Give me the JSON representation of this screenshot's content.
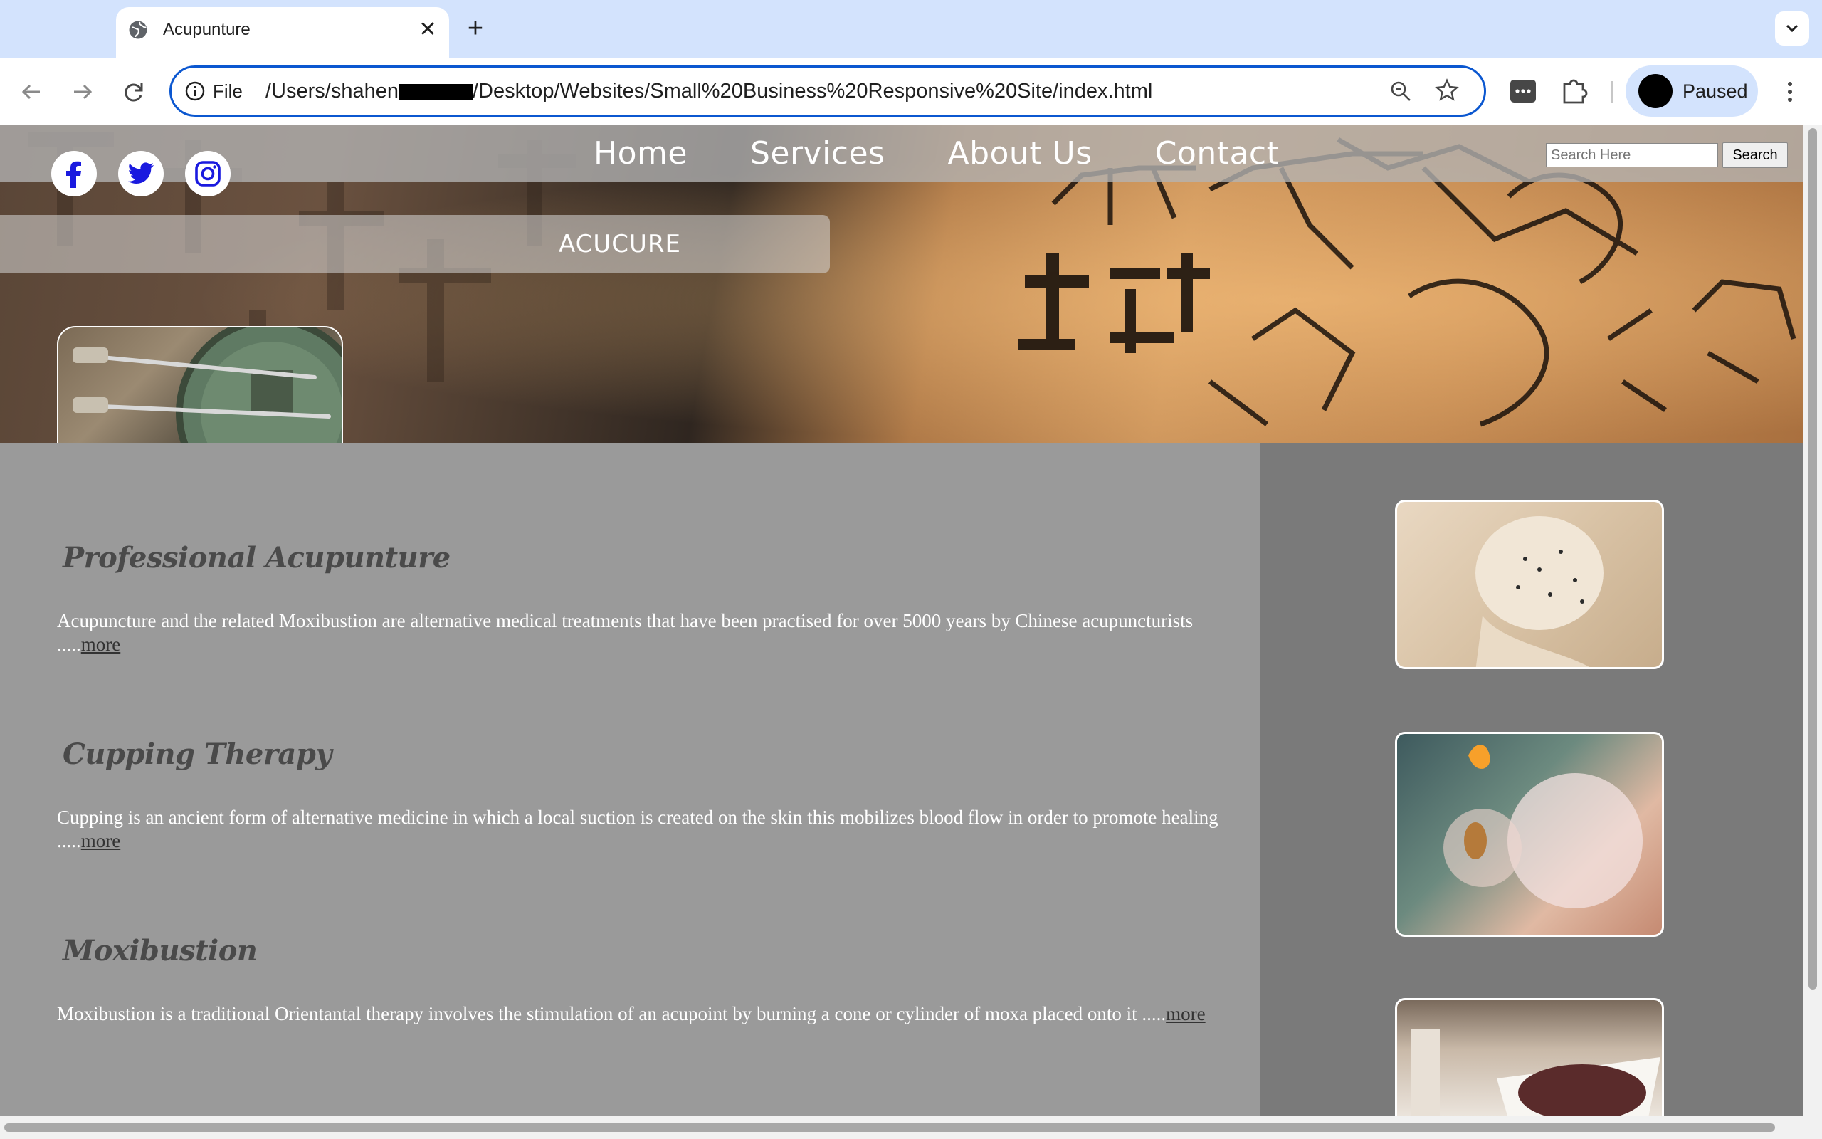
{
  "browser": {
    "tab_title": "Acupunture",
    "tab_close": "✕",
    "new_tab": "+",
    "address_scheme": "File",
    "address_prefix": "/Users/shahen",
    "address_suffix": "/Desktop/Websites/Small%20Business%20Responsive%20Site/index.html",
    "profile_label": "Paused"
  },
  "site": {
    "nav": [
      "Home",
      "Services",
      "About Us",
      "Contact"
    ],
    "search_placeholder": "Search Here",
    "search_button": "Search",
    "brand": "ACUCURE",
    "social": [
      "facebook-icon",
      "twitter-icon",
      "instagram-icon"
    ],
    "sections": [
      {
        "title": "Professional Acupunture",
        "text": "Acupuncture and the related Moxibustion are alternative medical treatments that have been practised for over 5000 years by Chinese acupuncturists .....",
        "more": "more"
      },
      {
        "title": "Cupping Therapy",
        "text": "Cupping is an ancient form of alternative medicine in which a local suction is created on the skin this mobilizes blood flow in order to promote healing .....",
        "more": "more"
      },
      {
        "title": "Moxibustion",
        "text": "Moxibustion is a traditional Orientantal therapy involves the stimulation of an acupoint by burning a cone or cylinder of moxa placed onto it .....",
        "more": "more"
      }
    ]
  },
  "colors": {
    "accent": "#0b57d0",
    "page_bg": "#9a9a9a",
    "sidebar_bg": "#7a7a7a",
    "social_icon": "#1a1adf"
  }
}
